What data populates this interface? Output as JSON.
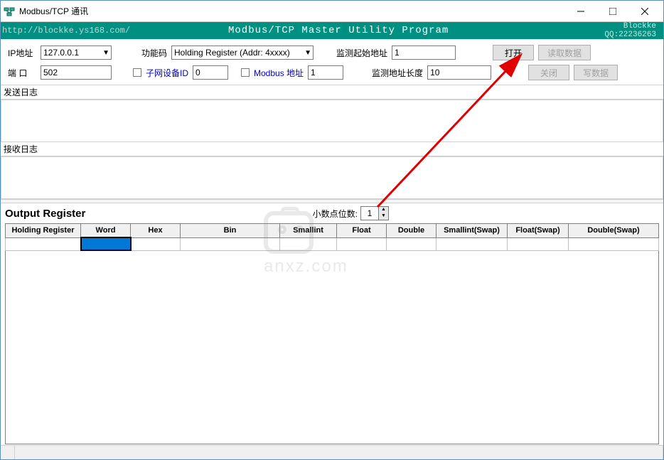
{
  "window": {
    "title": "Modbus/TCP 通讯"
  },
  "header": {
    "url": "http://blockke.ys168.com/",
    "program_title": "Modbus/TCP  Master Utility Program",
    "credit1": "Blockke",
    "credit2": "QQ:22236263"
  },
  "toolbar": {
    "ip_label": "IP地址",
    "ip_value": "127.0.0.1",
    "func_label": "功能码",
    "func_value": "Holding Register (Addr: 4xxxx)",
    "mon_start_label": "监测起始地址",
    "mon_start_value": "1",
    "open_btn": "打开",
    "read_btn": "读取数据",
    "port_label": "端 口",
    "port_value": "502",
    "subnet_label": "子网设备ID",
    "subnet_value": "0",
    "modbus_addr_label": "Modbus 地址",
    "modbus_addr_value": "1",
    "mon_len_label": "监测地址长度",
    "mon_len_value": "10",
    "close_btn": "关闭",
    "write_btn": "写数据"
  },
  "logs": {
    "send_label": "发送日志",
    "recv_label": "接收日志"
  },
  "output": {
    "title": "Output Register",
    "decimal_label": "小数点位数:",
    "decimal_value": "1",
    "cols": {
      "c0": "Holding Register",
      "c1": "Word",
      "c2": "Hex",
      "c3": "Bin",
      "c4": "Smallint",
      "c5": "Float",
      "c6": "Double",
      "c7": "Smallint(Swap)",
      "c8": "Float(Swap)",
      "c9": "Double(Swap)"
    }
  },
  "watermark": "anxz.com"
}
